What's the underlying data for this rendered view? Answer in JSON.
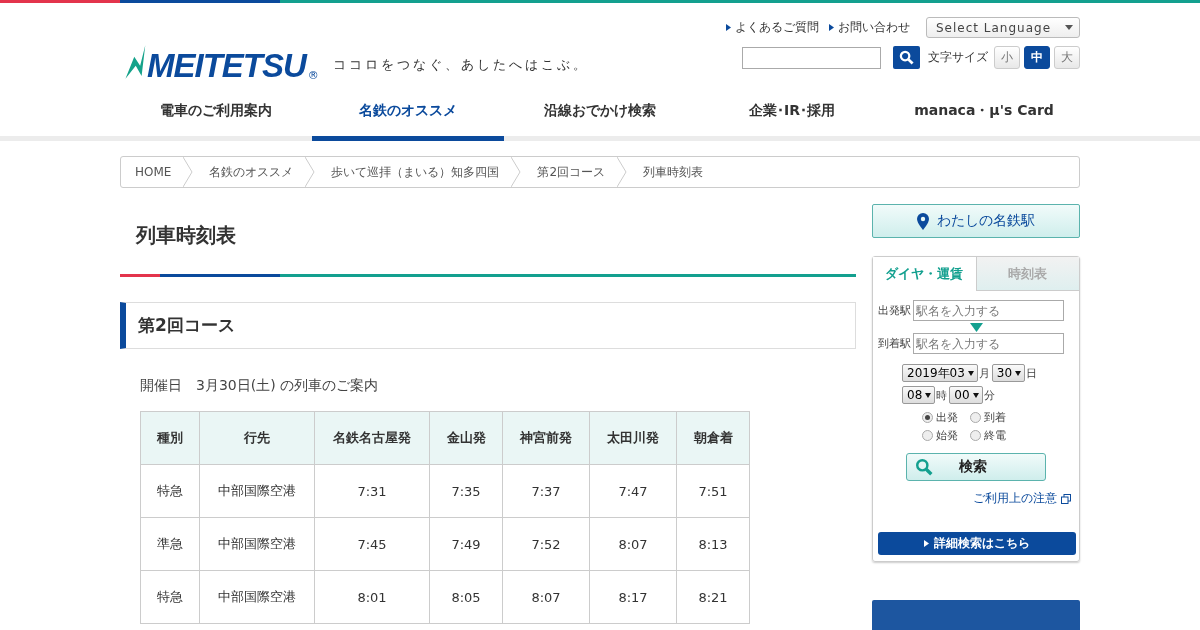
{
  "header": {
    "logo_text": "MEITETSU",
    "logo_mark": "®",
    "tagline": "ココロをつなぐ、あしたへはこぶ。",
    "utility_links": [
      "よくあるご質問",
      "お問い合わせ"
    ],
    "language_select": "Select Language",
    "text_size_label": "文字サイズ",
    "text_sizes": [
      {
        "label": "小",
        "selected": false
      },
      {
        "label": "中",
        "selected": true
      },
      {
        "label": "大",
        "selected": false
      }
    ]
  },
  "nav": [
    {
      "label": "電車のご利用案内",
      "selected": false
    },
    {
      "label": "名鉄のオススメ",
      "selected": true
    },
    {
      "label": "沿線おでかけ検索",
      "selected": false
    },
    {
      "label": "企業･IR･採用",
      "selected": false
    },
    {
      "label": "manaca・μ's Card",
      "selected": false
    }
  ],
  "breadcrumb": [
    "HOME",
    "名鉄のオススメ",
    "歩いて巡拝（まいる）知多四国",
    "第2回コース",
    "列車時刻表"
  ],
  "page_title": "列車時刻表",
  "section_title": "第2回コース",
  "intro": "開催日　3月30日(土) の列車のご案内",
  "table": {
    "columns": [
      "種別",
      "行先",
      "名鉄名古屋発",
      "金山発",
      "神宮前発",
      "太田川発",
      "朝倉着"
    ],
    "rows": [
      [
        "特急",
        "中部国際空港",
        "7:31",
        "7:35",
        "7:37",
        "7:47",
        "7:51"
      ],
      [
        "準急",
        "中部国際空港",
        "7:45",
        "7:49",
        "7:52",
        "8:07",
        "8:13"
      ],
      [
        "特急",
        "中部国際空港",
        "8:01",
        "8:05",
        "8:07",
        "8:17",
        "8:21"
      ]
    ]
  },
  "sidebar": {
    "my_station": "わたしの名鉄駅",
    "tabs": [
      {
        "label": "ダイヤ・運賃",
        "selected": true
      },
      {
        "label": "時刻表",
        "selected": false
      }
    ],
    "from_label": "出発駅",
    "from_placeholder": "駅名を入力する",
    "to_label": "到着駅",
    "to_placeholder": "駅名を入力する",
    "date": [
      {
        "value": "2019年03",
        "unit": "月"
      },
      {
        "value": "30",
        "unit": "日"
      }
    ],
    "time": [
      {
        "value": "08",
        "unit": "時"
      },
      {
        "value": "00",
        "unit": "分"
      }
    ],
    "options": [
      {
        "label": "出発",
        "selected": true
      },
      {
        "label": "到着",
        "selected": false
      },
      {
        "label": "始発",
        "selected": false
      },
      {
        "label": "終電",
        "selected": false
      }
    ],
    "search_button": "検索",
    "notice_link": "ご利用上の注意",
    "detail_button": "詳細検索はこちら"
  }
}
